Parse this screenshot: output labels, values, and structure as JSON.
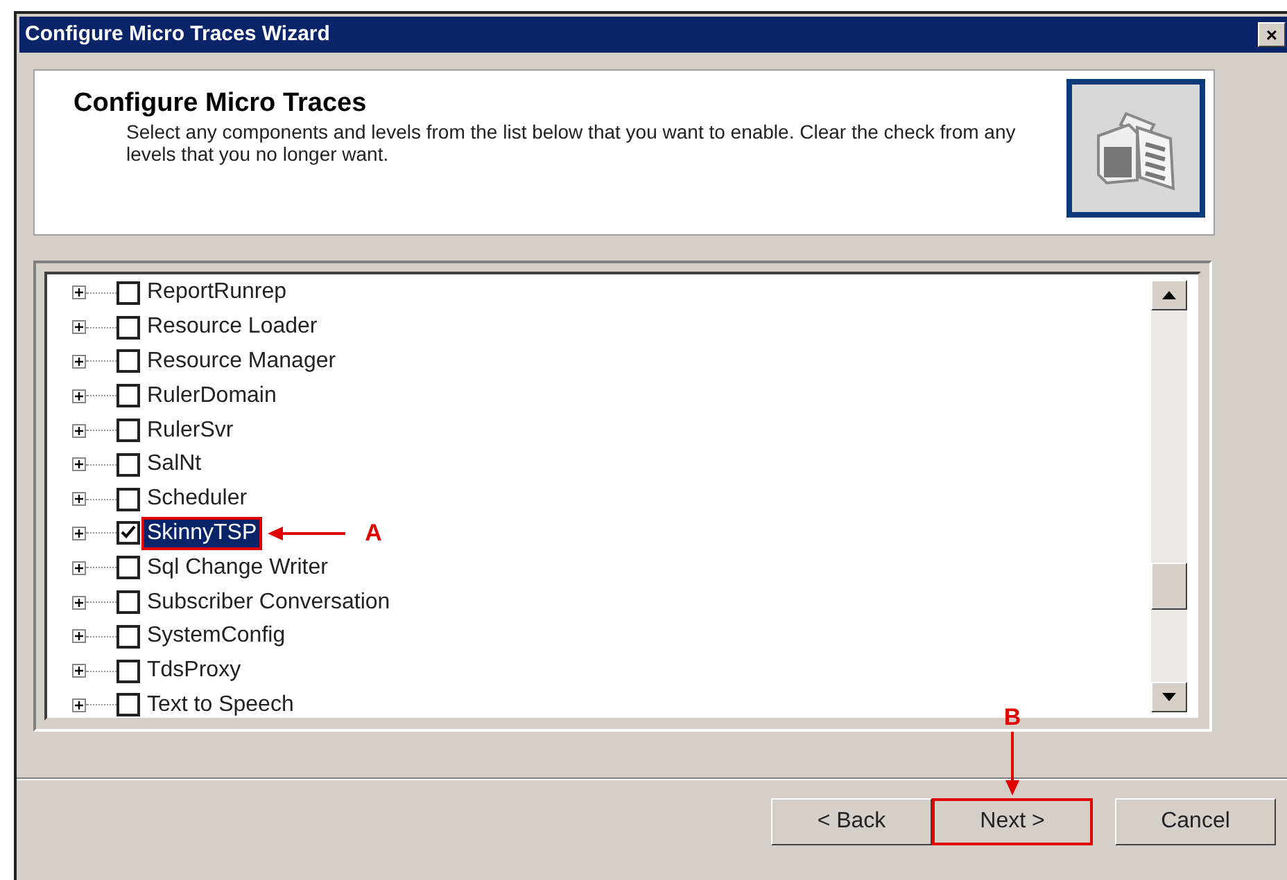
{
  "window": {
    "title": "Configure Micro Traces Wizard",
    "close": "×"
  },
  "header": {
    "title": "Configure Micro Traces",
    "description": "Select any components and levels from the list below that you want to enable.  Clear the check from any levels that you no longer want."
  },
  "tree": {
    "items": [
      {
        "label": "ReportRunrep",
        "checked": false,
        "selected": false
      },
      {
        "label": "Resource Loader",
        "checked": false,
        "selected": false
      },
      {
        "label": "Resource Manager",
        "checked": false,
        "selected": false
      },
      {
        "label": "RulerDomain",
        "checked": false,
        "selected": false
      },
      {
        "label": "RulerSvr",
        "checked": false,
        "selected": false
      },
      {
        "label": "SalNt",
        "checked": false,
        "selected": false
      },
      {
        "label": "Scheduler",
        "checked": false,
        "selected": false
      },
      {
        "label": "SkinnyTSP",
        "checked": true,
        "selected": true
      },
      {
        "label": "Sql Change Writer",
        "checked": false,
        "selected": false
      },
      {
        "label": "Subscriber Conversation",
        "checked": false,
        "selected": false
      },
      {
        "label": "SystemConfig",
        "checked": false,
        "selected": false
      },
      {
        "label": "TdsProxy",
        "checked": false,
        "selected": false
      },
      {
        "label": "Text to Speech",
        "checked": false,
        "selected": false
      }
    ]
  },
  "buttons": [
    {
      "label": "< Back",
      "highlighted": false
    },
    {
      "label": "Next >",
      "highlighted": true
    },
    {
      "label": "Cancel",
      "highlighted": false
    }
  ],
  "annotations": [
    {
      "label": "A"
    },
    {
      "label": "B"
    }
  ]
}
